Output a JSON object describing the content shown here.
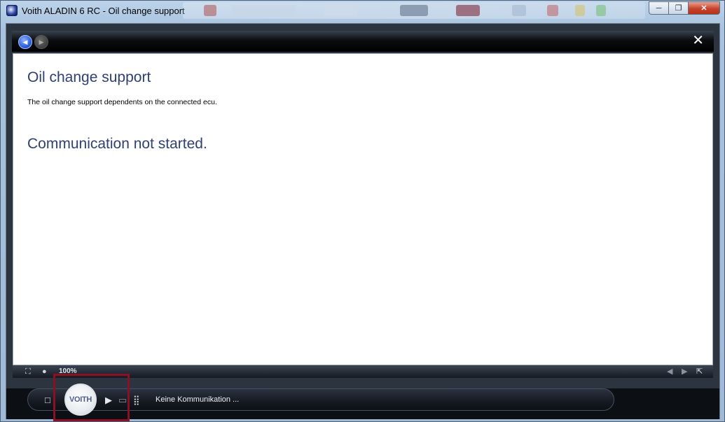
{
  "window": {
    "title": "Voith ALADIN 6 RC - Oil change support",
    "minimize_glyph": "─",
    "maximize_glyph": "❐",
    "close_glyph": "✕"
  },
  "toolbar": {
    "back_glyph": "◀",
    "forward_glyph": "▶",
    "close_glyph": "✕"
  },
  "page": {
    "title": "Oil change support",
    "description": "The oil change support dependents on the connected ecu.",
    "status_heading": "Communication not started."
  },
  "statusbar": {
    "zoom": "100%",
    "fit_glyph": "⛶",
    "comment_glyph": "●",
    "prev_glyph": "◀",
    "next_glyph": "▶",
    "popout_glyph": "⇱"
  },
  "bottom": {
    "logo_text": "VOITH",
    "stop_glyph": "□",
    "play_glyph": "▶",
    "screen_glyph": "▭",
    "grid_glyph": "⣿",
    "status": "Keine Kommunikation ..."
  },
  "colors": {
    "title_blue": "#2f4072",
    "highlight": "#8b1024"
  }
}
